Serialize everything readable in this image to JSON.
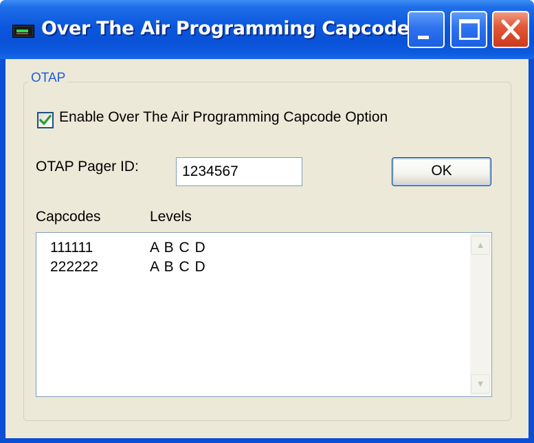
{
  "window": {
    "title": "Over The Air Programming Capcode",
    "controls": {
      "minimize_icon": "minimize-icon",
      "maximize_icon": "maximize-icon",
      "close_icon": "close-icon"
    },
    "colors": {
      "titlebar": "#0a52d8",
      "close_button": "#e25a3a",
      "client_background": "#ece9d8",
      "group_label": "#1f5cd9"
    }
  },
  "otap_group": {
    "label": "OTAP",
    "enable_checkbox": {
      "label": "Enable Over The Air Programming Capcode Option",
      "checked": true
    },
    "pager_id": {
      "label": "OTAP Pager ID:",
      "value": "1234567"
    },
    "ok_button": {
      "label": "OK"
    },
    "list": {
      "columns": [
        "Capcodes",
        "Levels"
      ],
      "rows": [
        {
          "capcode": "111111",
          "levels": "A B C D"
        },
        {
          "capcode": "222222",
          "levels": "A B C D"
        }
      ]
    }
  }
}
